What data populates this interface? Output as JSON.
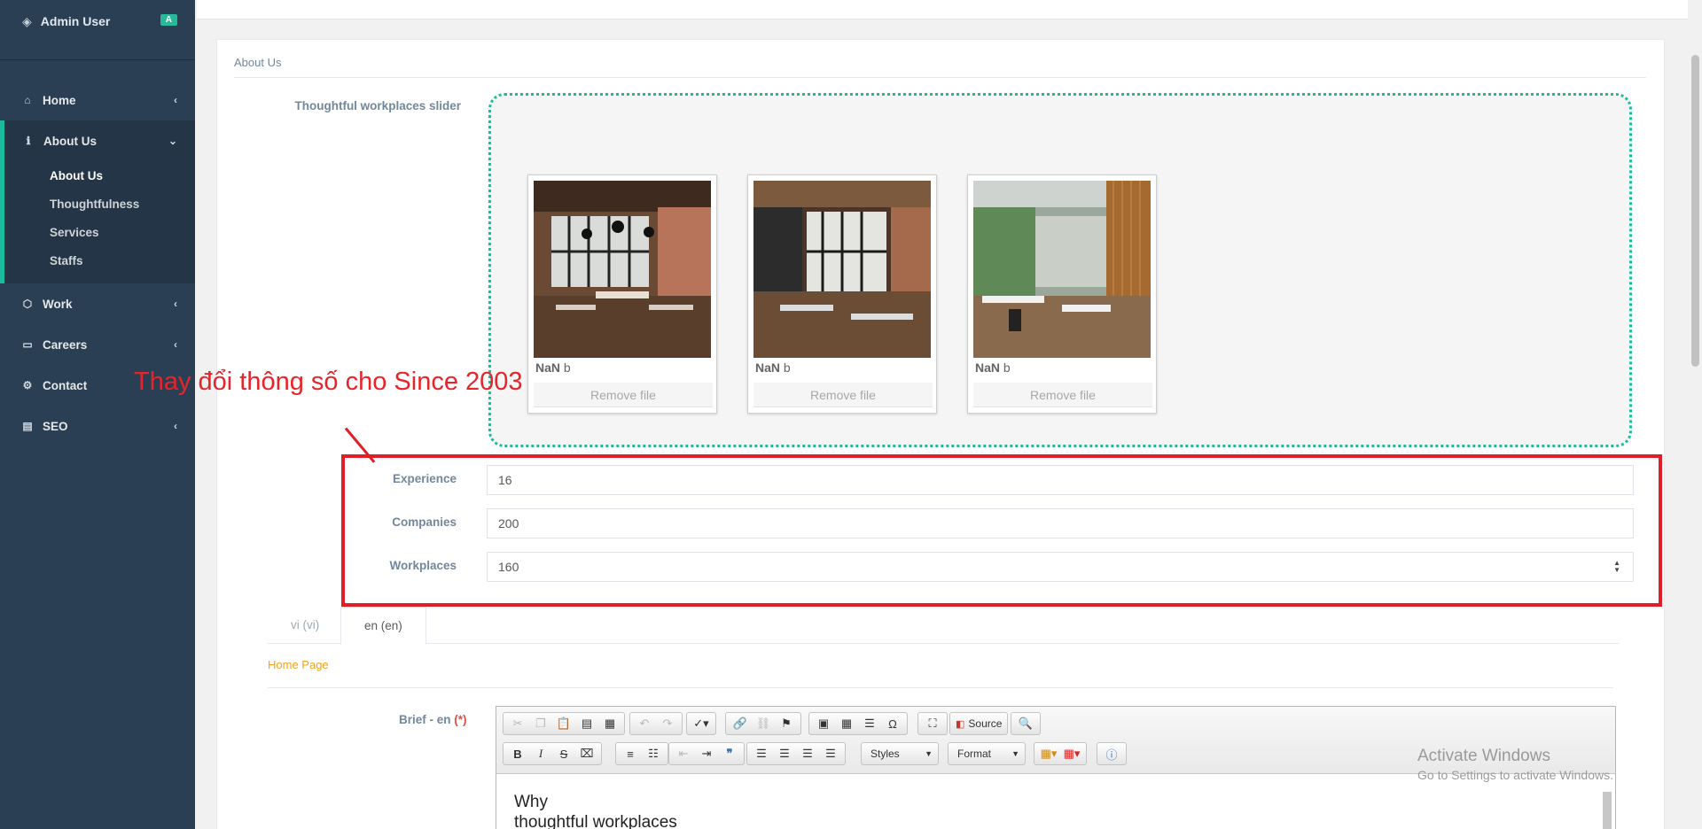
{
  "sidebar": {
    "user_name": "Admin User",
    "user_badge": "A",
    "menu": [
      {
        "label": "Home",
        "icon": "home-icon"
      },
      {
        "label": "About Us",
        "icon": "info-icon"
      },
      {
        "label": "Work",
        "icon": "cube-icon"
      },
      {
        "label": "Careers",
        "icon": "id-card-icon"
      },
      {
        "label": "Contact",
        "icon": "settings-icon"
      },
      {
        "label": "SEO",
        "icon": "book-icon"
      }
    ],
    "submenu": [
      "About Us",
      "Thoughtfulness",
      "Services",
      "Staffs"
    ]
  },
  "panel": {
    "title": "About Us",
    "slider_label": "Thoughtful workplaces slider",
    "previews": [
      {
        "size_value": "NaN",
        "size_unit": "b",
        "remove_label": "Remove file"
      },
      {
        "size_value": "NaN",
        "size_unit": "b",
        "remove_label": "Remove file"
      },
      {
        "size_value": "NaN",
        "size_unit": "b",
        "remove_label": "Remove file"
      }
    ],
    "fields": {
      "experience_label": "Experience",
      "experience_value": "16",
      "companies_label": "Companies",
      "companies_value": "200",
      "workplaces_label": "Workplaces",
      "workplaces_value": "160"
    },
    "annotation_text": "Thay đổi thông số cho Since 2003",
    "tabs": [
      "vi (vi)",
      "en (en)"
    ],
    "home_page_link": "Home Page",
    "brief_label": "Brief - en",
    "brief_required": "(*)"
  },
  "editor": {
    "source_label": "Source",
    "styles_label": "Styles",
    "format_label": "Format",
    "content_line1": "Why",
    "content_line2": "thoughtful workplaces"
  },
  "watermark": {
    "title": "Activate Windows",
    "subtitle": "Go to Settings to activate Windows."
  },
  "colors": {
    "sidebar_bg": "#2a3f54",
    "accent": "#1abb9c",
    "highlight_red": "#e11d28",
    "link_orange": "#f5a21b"
  }
}
